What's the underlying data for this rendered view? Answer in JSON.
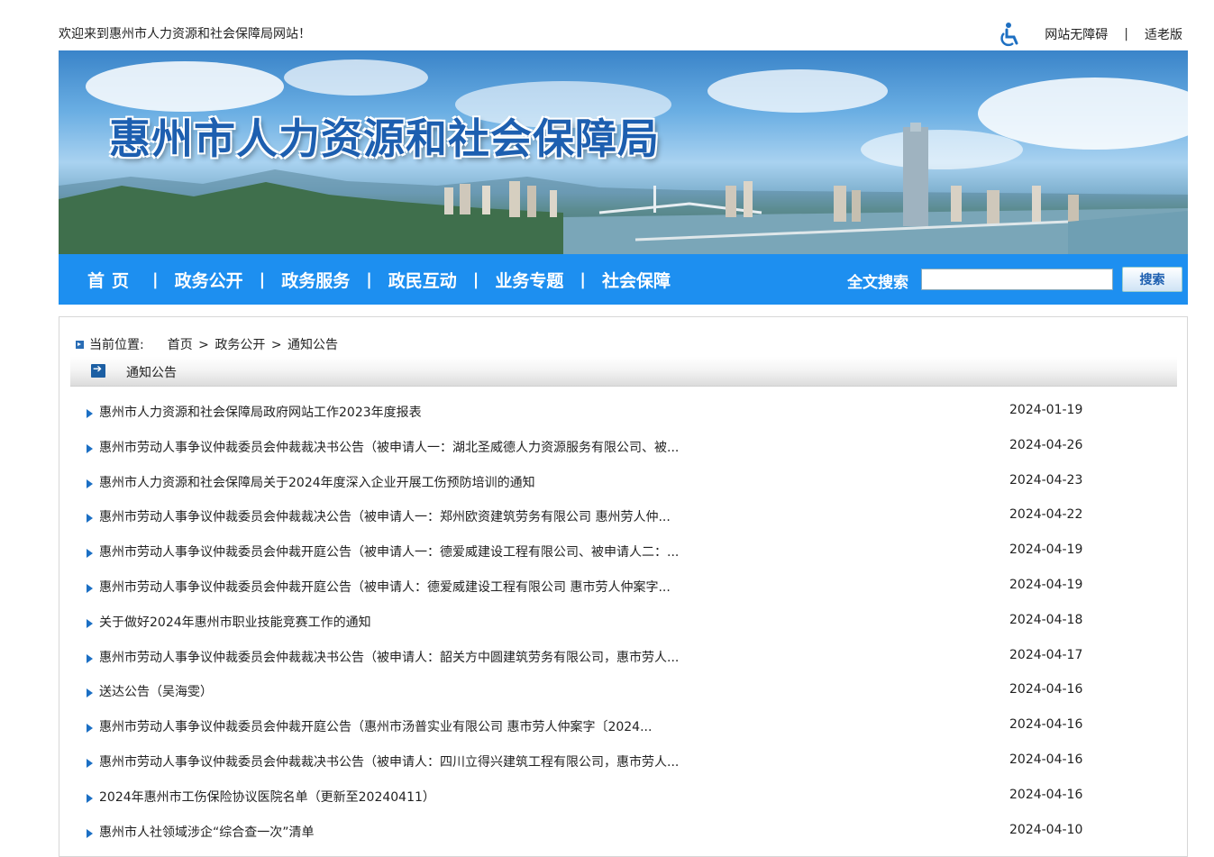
{
  "top": {
    "welcome": "欢迎来到惠州市人力资源和社会保障局网站！",
    "accessibility": "网站无障碍",
    "separator": "|",
    "elderly": "适老版"
  },
  "banner": {
    "title": "惠州市人力资源和社会保障局"
  },
  "nav": {
    "items": [
      "首页",
      "政务公开",
      "政务服务",
      "政民互动",
      "业务专题",
      "社会保障"
    ],
    "separator": "|",
    "search_label": "全文搜索",
    "search_value": "",
    "search_button": "搜索"
  },
  "breadcrumb": {
    "label": "当前位置:",
    "path": [
      "首页",
      ">",
      "政务公开",
      ">",
      "通知公告"
    ]
  },
  "section": {
    "title": "通知公告"
  },
  "list": [
    {
      "title": "惠州市人力资源和社会保障局政府网站工作2023年度报表",
      "date": "2024-01-19"
    },
    {
      "title": "惠州市劳动人事争议仲裁委员会仲裁裁决书公告（被申请人一：湖北圣威德人力资源服务有限公司、被...",
      "date": "2024-04-26"
    },
    {
      "title": "惠州市人力资源和社会保障局关于2024年度深入企业开展工伤预防培训的通知",
      "date": "2024-04-23"
    },
    {
      "title": "惠州市劳动人事争议仲裁委员会仲裁裁决公告（被申请人一：郑州欧资建筑劳务有限公司 惠州劳人仲...",
      "date": "2024-04-22"
    },
    {
      "title": "惠州市劳动人事争议仲裁委员会仲裁开庭公告（被申请人一：德爱威建设工程有限公司、被申请人二：...",
      "date": "2024-04-19"
    },
    {
      "title": "惠州市劳动人事争议仲裁委员会仲裁开庭公告（被申请人：德爱威建设工程有限公司 惠市劳人仲案字...",
      "date": "2024-04-19"
    },
    {
      "title": "关于做好2024年惠州市职业技能竞赛工作的通知",
      "date": "2024-04-18"
    },
    {
      "title": "惠州市劳动人事争议仲裁委员会仲裁裁决书公告（被申请人：韶关方中圆建筑劳务有限公司，惠市劳人...",
      "date": "2024-04-17"
    },
    {
      "title": "送达公告（吴海雯）",
      "date": "2024-04-16"
    },
    {
      "title": "惠州市劳动人事争议仲裁委员会仲裁开庭公告（惠州市汤普实业有限公司 惠市劳人仲案字〔2024...",
      "date": "2024-04-16"
    },
    {
      "title": "惠州市劳动人事争议仲裁委员会仲裁裁决书公告（被申请人：四川立得兴建筑工程有限公司，惠市劳人...",
      "date": "2024-04-16"
    },
    {
      "title": "2024年惠州市工伤保险协议医院名单（更新至20240411）",
      "date": "2024-04-16"
    },
    {
      "title": "惠州市人社领域涉企“综合查一次”清单",
      "date": "2024-04-10"
    }
  ]
}
